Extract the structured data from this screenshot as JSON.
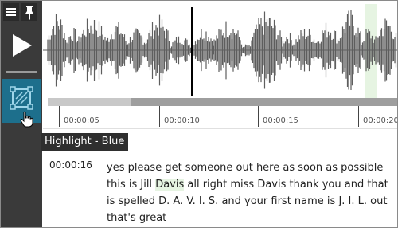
{
  "toolbar": {
    "menu_icon": "hamburger-icon",
    "pin_icon": "pin-icon",
    "play_icon": "play-icon",
    "highlight_icon": "highlight-tool-icon",
    "active_color": "#1d6f8c"
  },
  "waveform": {
    "playback_progress": 0.24,
    "highlight_color": "#e6f4e2"
  },
  "timeline": {
    "labels": [
      "00:00:05",
      "00:00:10",
      "00:00:15",
      "00:00:20"
    ]
  },
  "tooltip": {
    "text": "Highlight - Blue"
  },
  "transcript": {
    "timestamp": "00:00:16",
    "text_before": "yes please get someone out here as soon as possible this is Jill ",
    "highlighted": "Davis",
    "text_after": " all right miss Davis thank you and that is spelled D. A. V. I. S. and your first name is J. I. L. out that's great"
  }
}
